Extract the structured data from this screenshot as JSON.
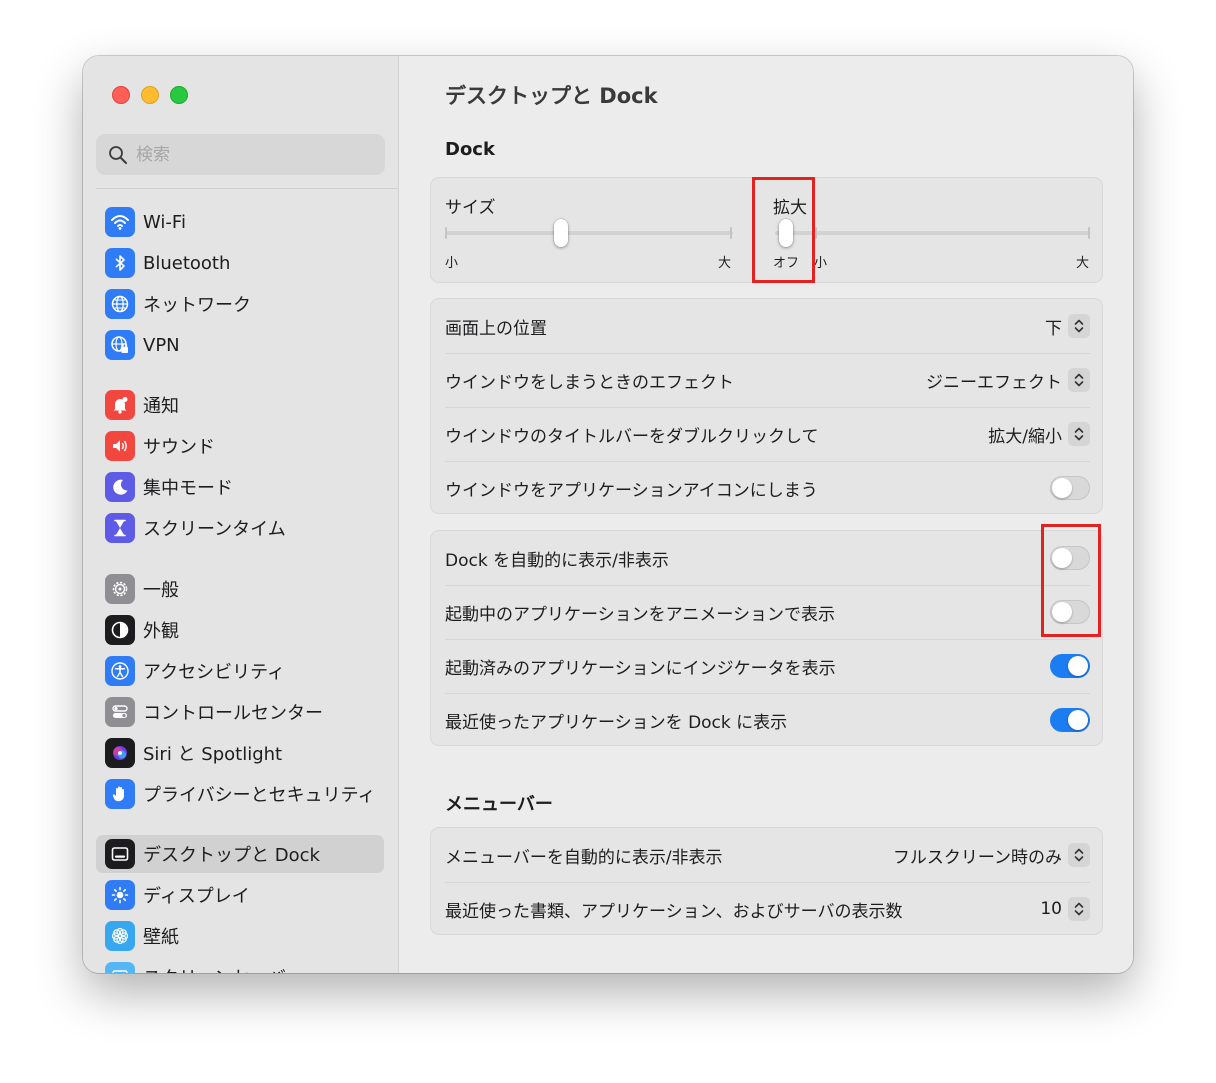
{
  "search": {
    "placeholder": "検索"
  },
  "sidebar": {
    "items": [
      {
        "label": "Wi-Fi",
        "icon": "wifi-icon",
        "color": "#2f7cf6"
      },
      {
        "label": "Bluetooth",
        "icon": "bluetooth-icon",
        "color": "#2f7cf6"
      },
      {
        "label": "ネットワーク",
        "icon": "globe-icon",
        "color": "#2f7cf6"
      },
      {
        "label": "VPN",
        "icon": "vpn-globe-icon",
        "color": "#2f7cf6"
      },
      {
        "label": "通知",
        "icon": "bell-icon",
        "color": "#f2473f"
      },
      {
        "label": "サウンド",
        "icon": "speaker-icon",
        "color": "#f2473f"
      },
      {
        "label": "集中モード",
        "icon": "moon-icon",
        "color": "#5e5ce6"
      },
      {
        "label": "スクリーンタイム",
        "icon": "hourglass-icon",
        "color": "#5e5ce6"
      },
      {
        "label": "一般",
        "icon": "gear-icon",
        "color": "#8e8e93"
      },
      {
        "label": "外観",
        "icon": "appearance-icon",
        "color": "#1c1c1e"
      },
      {
        "label": "アクセシビリティ",
        "icon": "accessibility-icon",
        "color": "#2f7cf6"
      },
      {
        "label": "コントロールセンター",
        "icon": "control-center-icon",
        "color": "#8e8e93"
      },
      {
        "label": "Siri と Spotlight",
        "icon": "siri-icon",
        "color": "#1c1c1e"
      },
      {
        "label": "プライバシーとセキュリティ",
        "icon": "hand-icon",
        "color": "#2f7cf6"
      },
      {
        "label": "デスクトップと Dock",
        "icon": "dock-icon",
        "color": "#1c1c1e",
        "selected": true
      },
      {
        "label": "ディスプレイ",
        "icon": "sun-icon",
        "color": "#2f7cf6"
      },
      {
        "label": "壁紙",
        "icon": "flower-icon",
        "color": "#39a7f0"
      },
      {
        "label": "スクリーンセーバ",
        "icon": "screensaver-icon",
        "color": "#55b6f5"
      }
    ]
  },
  "main": {
    "title": "デスクトップと Dock",
    "dock_header": "Dock",
    "size_slider": {
      "label": "サイズ",
      "min_label": "小",
      "max_label": "大",
      "value": 0.4
    },
    "magnify_slider": {
      "label": "拡大",
      "off_label": "オフ",
      "min_label": "小",
      "max_label": "大",
      "value": 0
    },
    "group1": [
      {
        "label": "画面上の位置",
        "value": "下"
      },
      {
        "label": "ウインドウをしまうときのエフェクト",
        "value": "ジニーエフェクト"
      },
      {
        "label": "ウインドウのタイトルバーをダブルクリックして",
        "value": "拡大/縮小"
      },
      {
        "label": "ウインドウをアプリケーションアイコンにしまう",
        "toggle": false
      }
    ],
    "group2": [
      {
        "label": "Dock を自動的に表示/非表示",
        "toggle": false
      },
      {
        "label": "起動中のアプリケーションをアニメーションで表示",
        "toggle": false
      },
      {
        "label": "起動済みのアプリケーションにインジケータを表示",
        "toggle": true
      },
      {
        "label": "最近使ったアプリケーションを Dock に表示",
        "toggle": true
      }
    ],
    "menubar_header": "メニューバー",
    "group3": [
      {
        "label": "メニューバーを自動的に表示/非表示",
        "value": "フルスクリーン時のみ"
      },
      {
        "label": "最近使った書類、アプリケーション、およびサーバの表示数",
        "value": "10"
      }
    ]
  },
  "colors": {
    "accent": "#1c7cf2",
    "highlight": "#e52222"
  }
}
